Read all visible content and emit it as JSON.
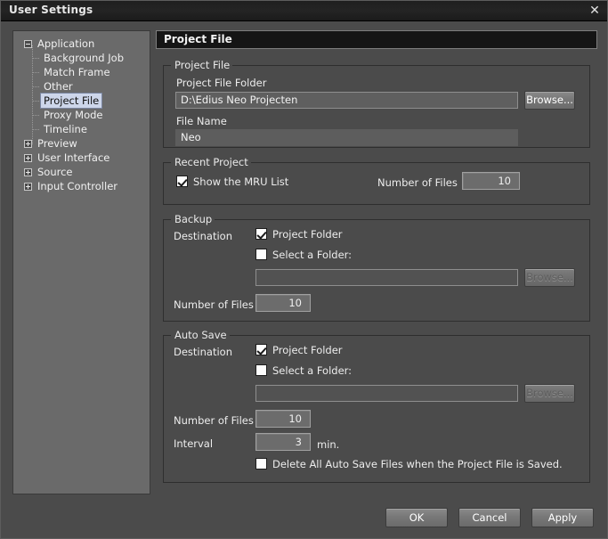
{
  "window": {
    "title": "User Settings",
    "close_icon": "close-icon"
  },
  "tree": {
    "items": [
      {
        "label": "Application",
        "level": 0,
        "toggle": "minus",
        "selected": false
      },
      {
        "label": "Background Job",
        "level": 1,
        "toggle": "none",
        "selected": false
      },
      {
        "label": "Match Frame",
        "level": 1,
        "toggle": "none",
        "selected": false
      },
      {
        "label": "Other",
        "level": 1,
        "toggle": "none",
        "selected": false
      },
      {
        "label": "Project File",
        "level": 1,
        "toggle": "none",
        "selected": true
      },
      {
        "label": "Proxy Mode",
        "level": 1,
        "toggle": "none",
        "selected": false
      },
      {
        "label": "Timeline",
        "level": 1,
        "toggle": "none",
        "selected": false
      },
      {
        "label": "Preview",
        "level": 0,
        "toggle": "plus",
        "selected": false
      },
      {
        "label": "User Interface",
        "level": 0,
        "toggle": "plus",
        "selected": false
      },
      {
        "label": "Source",
        "level": 0,
        "toggle": "plus",
        "selected": false
      },
      {
        "label": "Input Controller",
        "level": 0,
        "toggle": "plus",
        "selected": false
      }
    ]
  },
  "pane": {
    "header": "Project File"
  },
  "project_file": {
    "group_title": "Project File",
    "folder_label": "Project File Folder",
    "folder_value": "D:\\Edius Neo Projecten",
    "folder_browse_label": "Browse...",
    "filename_label": "File Name",
    "filename_value": "Neo"
  },
  "recent_project": {
    "group_title": "Recent Project",
    "mru_label": "Show the MRU List",
    "mru_checked": true,
    "number_of_files_label": "Number of Files",
    "number_of_files_value": "10"
  },
  "backup": {
    "group_title": "Backup",
    "destination_label": "Destination",
    "project_folder_label": "Project Folder",
    "project_folder_checked": true,
    "select_folder_label": "Select a Folder:",
    "select_folder_checked": false,
    "folder_value": "",
    "browse_label": "Browse...",
    "number_of_files_label": "Number of Files",
    "number_of_files_value": "10"
  },
  "auto_save": {
    "group_title": "Auto Save",
    "destination_label": "Destination",
    "project_folder_label": "Project Folder",
    "project_folder_checked": true,
    "select_folder_label": "Select a Folder:",
    "select_folder_checked": false,
    "folder_value": "",
    "browse_label": "Browse...",
    "number_of_files_label": "Number of Files",
    "number_of_files_value": "10",
    "interval_label": "Interval",
    "interval_value": "3",
    "interval_unit": "min.",
    "delete_label": "Delete All Auto Save Files when the Project File is Saved.",
    "delete_checked": false
  },
  "footer": {
    "ok_label": "OK",
    "cancel_label": "Cancel",
    "apply_label": "Apply"
  },
  "colors": {
    "dialog_bg": "#4b4b4b",
    "tree_bg": "#6a6a6a",
    "selection": "#cdd6ea",
    "header_bg": "#151515"
  }
}
